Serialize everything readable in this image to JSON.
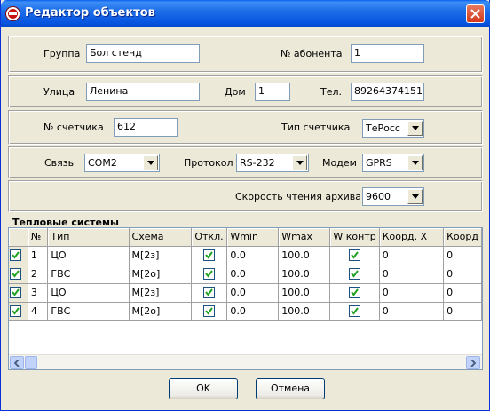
{
  "window": {
    "title": "Редактор объектов"
  },
  "fields": {
    "group_label": "Группа",
    "group_value": "Бол стенд",
    "subscriber_label": "№ абонента",
    "subscriber_value": "1",
    "street_label": "Улица",
    "street_value": "Ленина",
    "house_label": "Дом",
    "house_value": "1",
    "phone_label": "Тел.",
    "phone_value": "89264374151",
    "meter_no_label": "№ счетчика",
    "meter_no_value": "612",
    "meter_type_label": "Тип счетчика",
    "meter_type_value": "ТеРосс",
    "link_label": "Связь",
    "link_value": "COM2",
    "protocol_label": "Протокол",
    "protocol_value": "RS-232",
    "modem_label": "Модем",
    "modem_value": "GPRS",
    "speed_label": "Скорость чтения архива",
    "speed_value": "9600"
  },
  "systems": {
    "title": "Тепловые системы",
    "columns": [
      "№",
      "Тип",
      "Схема",
      "Откл.",
      "Wmin",
      "Wmax",
      "W контр",
      "Коорд. X",
      "Коорд"
    ],
    "rows": [
      {
        "num": "1",
        "type": "ЦО",
        "scheme": "М[2з]",
        "disabled": true,
        "wmin": "0.0",
        "wmax": "100.0",
        "wcontr": true,
        "x": "0",
        "y": "0"
      },
      {
        "num": "2",
        "type": "ГВС",
        "scheme": "М[2о]",
        "disabled": true,
        "wmin": "0.0",
        "wmax": "100.0",
        "wcontr": true,
        "x": "0",
        "y": "0"
      },
      {
        "num": "3",
        "type": "ЦО",
        "scheme": "М[2з]",
        "disabled": true,
        "wmin": "0.0",
        "wmax": "100.0",
        "wcontr": true,
        "x": "0",
        "y": "0"
      },
      {
        "num": "4",
        "type": "ГВС",
        "scheme": "М[2о]",
        "disabled": true,
        "wmin": "0.0",
        "wmax": "100.0",
        "wcontr": true,
        "x": "0",
        "y": "0"
      }
    ]
  },
  "buttons": {
    "ok": "OK",
    "cancel": "Отмена"
  },
  "colors": {
    "titlebar": "#0553e0",
    "face": "#ece9d8",
    "border": "#7f9db9"
  }
}
